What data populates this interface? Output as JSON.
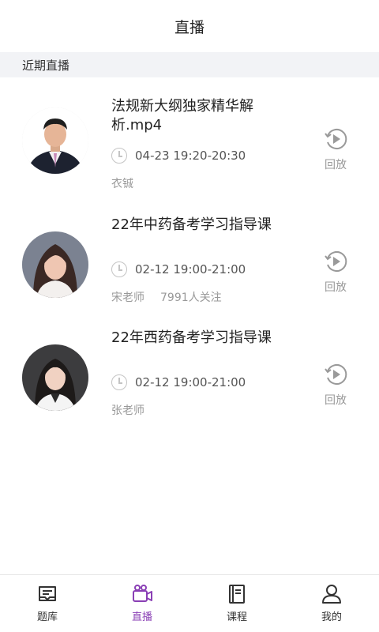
{
  "header": {
    "title": "直播"
  },
  "section": {
    "title": "近期直播"
  },
  "lives": [
    {
      "title": "法规新大纲独家精华解析.mp4",
      "time": "04-23 19:20-20:30",
      "teacher": "衣铖",
      "followers": "",
      "action": "回放"
    },
    {
      "title": "22年中药备考学习指导课",
      "time": "02-12 19:00-21:00",
      "teacher": "宋老师",
      "followers": "7991人关注",
      "action": "回放"
    },
    {
      "title": "22年西药备考学习指导课",
      "time": "02-12 19:00-21:00",
      "teacher": "张老师",
      "followers": "",
      "action": "回放"
    }
  ],
  "tabbar": {
    "tabs": [
      {
        "label": "题库",
        "icon": "question-bank-icon"
      },
      {
        "label": "直播",
        "icon": "live-camera-icon"
      },
      {
        "label": "课程",
        "icon": "course-book-icon"
      },
      {
        "label": "我的",
        "icon": "profile-icon"
      }
    ],
    "active_index": 1
  },
  "colors": {
    "accent": "#8a3fb5",
    "section_bg": "#f2f3f6",
    "muted": "#999999"
  }
}
